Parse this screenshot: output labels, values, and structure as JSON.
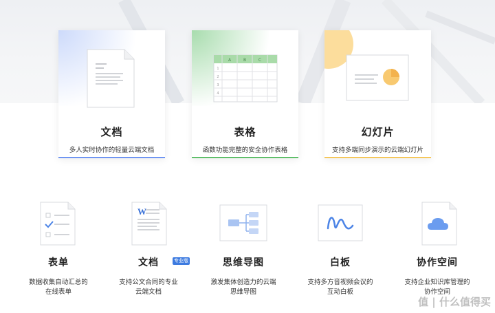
{
  "products": [
    {
      "title": "文档",
      "desc": "多人实时协作的轻量云端文档",
      "accent": "#6f95f2"
    },
    {
      "title": "表格",
      "desc": "函数功能完整的安全协作表格",
      "accent": "#5fbf6a"
    },
    {
      "title": "幻灯片",
      "desc": "支持多端同步演示的云端幻灯片",
      "accent": "#f5c75b"
    }
  ],
  "sheet_columns": [
    "A",
    "B",
    "C"
  ],
  "sheet_rows": [
    "1",
    "2",
    "3",
    "4"
  ],
  "features": [
    {
      "title": "表单",
      "desc1": "数据收集自动汇总的",
      "desc2": "在线表单",
      "icon": "form-icon"
    },
    {
      "title": "文档",
      "badge": "专业版",
      "desc1": "支持公文合同的专业",
      "desc2": "云端文档",
      "icon": "word-doc-icon"
    },
    {
      "title": "思维导图",
      "desc1": "激发集体创造力的云端",
      "desc2": "思维导图",
      "icon": "mindmap-icon"
    },
    {
      "title": "白板",
      "desc1": "支持多方音视频会议的",
      "desc2": "互动白板",
      "icon": "whiteboard-icon"
    },
    {
      "title": "协作空间",
      "desc1": "支持企业知识库管理的",
      "desc2": "协作空间",
      "icon": "cloud-space-icon"
    }
  ],
  "watermark": "值 | 什么值得买",
  "word_letter": "W"
}
